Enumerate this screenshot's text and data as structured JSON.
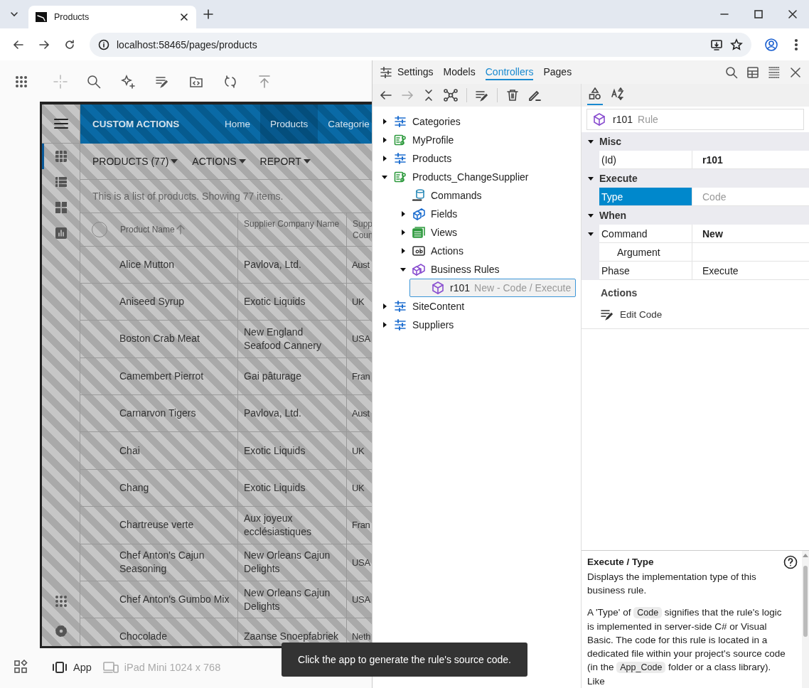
{
  "browser": {
    "tab_title": "Products",
    "url": "localhost:58465/pages/products"
  },
  "app": {
    "title": "CUSTOM ACTIONS",
    "nav": [
      {
        "label": "Home",
        "selected": false
      },
      {
        "label": "Products",
        "selected": true
      },
      {
        "label": "Categorie",
        "selected": false
      }
    ],
    "views": [
      {
        "kind": "grid",
        "selected": true
      },
      {
        "kind": "list",
        "selected": false
      },
      {
        "kind": "cards",
        "selected": false
      },
      {
        "kind": "chart",
        "selected": false
      }
    ],
    "menus": [
      "PRODUCTS (77)",
      "ACTIONS",
      "REPORT"
    ],
    "select_all_checked": false,
    "description": "This is a list of products. Showing 77 items.",
    "columns": [
      {
        "label": "Product Name",
        "sorted": true
      },
      {
        "label": "Supplier Company Name",
        "sorted": false
      },
      {
        "label": "Supp Coun",
        "sorted": false
      }
    ],
    "rows": [
      [
        "Alice Mutton",
        "Pavlova, Ltd.",
        "Aust"
      ],
      [
        "Aniseed Syrup",
        "Exotic Liquids",
        "UK"
      ],
      [
        "Boston Crab Meat",
        "New England Seafood Cannery",
        "USA"
      ],
      [
        "Camembert Pierrot",
        "Gai pâturage",
        "Fran"
      ],
      [
        "Carnarvon Tigers",
        "Pavlova, Ltd.",
        "Aust"
      ],
      [
        "Chai",
        "Exotic Liquids",
        "UK"
      ],
      [
        "Chang",
        "Exotic Liquids",
        "UK"
      ],
      [
        "Chartreuse verte",
        "Aux joyeux ecclésiastiques",
        "Fran"
      ],
      [
        "Chef Anton's Cajun Seasoning",
        "New Orleans Cajun Delights",
        "USA"
      ],
      [
        "Chef Anton's Gumbo Mix",
        "New Orleans Cajun Delights",
        "USA"
      ],
      [
        "Chocolade",
        "Zaanse Snoepfabriek",
        "Neth"
      ]
    ]
  },
  "designer": {
    "tabs": [
      {
        "label": "Settings",
        "selected": false
      },
      {
        "label": "Models",
        "selected": false
      },
      {
        "label": "Controllers",
        "selected": true
      },
      {
        "label": "Pages",
        "selected": false
      }
    ],
    "tree": [
      {
        "label": "Categories",
        "kind": "controller",
        "expanded": false,
        "selected": false
      },
      {
        "label": "MyProfile",
        "kind": "custom",
        "expanded": false,
        "selected": false
      },
      {
        "label": "Products",
        "kind": "controller",
        "expanded": false,
        "selected": false
      },
      {
        "label": "Products_ChangeSupplier",
        "kind": "custom",
        "expanded": true,
        "selected": false,
        "children": [
          {
            "label": "Commands",
            "kind": "sql",
            "selected": false
          },
          {
            "label": "Fields",
            "kind": "fields",
            "expanded": false,
            "selected": false
          },
          {
            "label": "Views",
            "kind": "views",
            "expanded": false,
            "selected": false
          },
          {
            "label": "Actions",
            "kind": "actions",
            "expanded": false,
            "selected": false
          },
          {
            "label": "Business Rules",
            "kind": "rules",
            "expanded": true,
            "selected": false,
            "children": [
              {
                "label": "r101",
                "detail": "New - Code / Execute",
                "kind": "rule",
                "selected": true
              }
            ]
          }
        ]
      },
      {
        "label": "SiteContent",
        "kind": "controller",
        "expanded": false,
        "selected": false
      },
      {
        "label": "Suppliers",
        "kind": "controller",
        "expanded": false,
        "selected": false
      }
    ],
    "sort_modes": [
      {
        "kind": "categorized",
        "selected": true
      },
      {
        "kind": "alphabetical",
        "selected": false
      }
    ],
    "object": {
      "name": "r101",
      "type": "Rule"
    },
    "groups": [
      {
        "name": "Misc",
        "expanded": true,
        "rows": [
          {
            "name": "(Id)",
            "value": "r101",
            "bold": true,
            "dimmed": false,
            "selected": false
          }
        ]
      },
      {
        "name": "Execute",
        "expanded": true,
        "rows": [
          {
            "name": "Type",
            "value": "Code",
            "bold": false,
            "dimmed": true,
            "selected": true
          }
        ]
      },
      {
        "name": "When",
        "expanded": true,
        "rows": [
          {
            "name": "Command",
            "value": "New",
            "bold": true,
            "dimmed": false,
            "selected": false,
            "expanded": true,
            "children": [
              {
                "name": "Argument",
                "selected": false
              }
            ]
          },
          {
            "name": "Phase",
            "value": "Execute",
            "bold": false,
            "dimmed": false,
            "selected": false
          }
        ]
      }
    ],
    "actions_title": "Actions",
    "actions": [
      {
        "label": "Edit Code"
      }
    ],
    "help": {
      "title": "Execute / Type",
      "paragraphs": [
        [
          {
            "kind": "text",
            "text": "Displays the implementation type of this business rule."
          }
        ],
        [
          {
            "kind": "text",
            "text": "A 'Type' of "
          },
          {
            "kind": "code",
            "text": "Code"
          },
          {
            "kind": "text",
            "text": " signifies that the rule's logic is implemented in server-side C# or Visual Basic. The code for this rule is located in a dedicated file within your project's source code (in the "
          },
          {
            "kind": "code",
            "text": "App_Code"
          },
          {
            "kind": "text",
            "text": " folder or a class library). Like"
          }
        ]
      ]
    }
  },
  "footer": {
    "device": "App",
    "preset": "iPad Mini 1024 x 768",
    "tooltip": "Click the app to generate the rule's source code."
  }
}
